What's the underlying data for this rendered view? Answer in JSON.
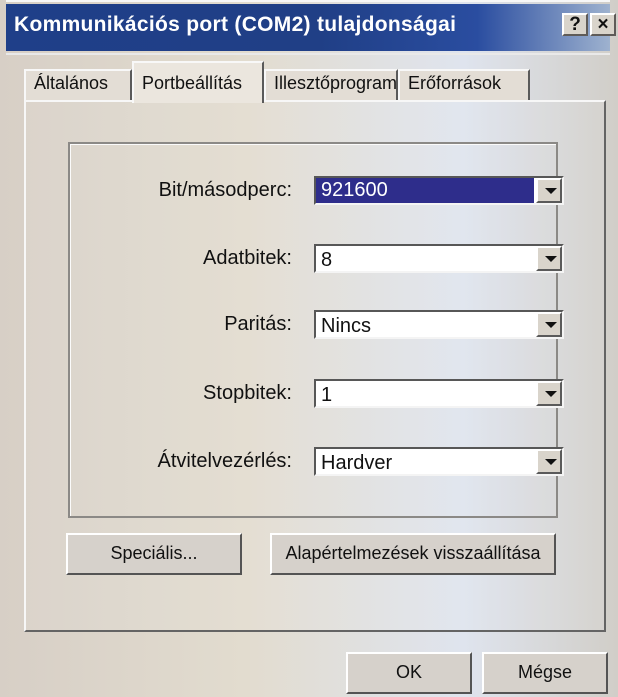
{
  "window": {
    "title": "Kommunikációs port (COM2) tulajdonságai",
    "help_button": "?",
    "close_button": "×"
  },
  "tabs": [
    {
      "label": "Általános"
    },
    {
      "label": "Portbeállítás"
    },
    {
      "label": "Illesztőprogram"
    },
    {
      "label": "Erőforrások"
    }
  ],
  "settings": {
    "fields": [
      {
        "label": "Bit/másodperc:",
        "value": "921600"
      },
      {
        "label": "Adatbitek:",
        "value": "8"
      },
      {
        "label": "Paritás:",
        "value": "Nincs"
      },
      {
        "label": "Stopbitek:",
        "value": "1"
      },
      {
        "label": "Átvitelvezérlés:",
        "value": "Hardver"
      }
    ]
  },
  "buttons": {
    "advanced": "Speciális...",
    "restore_defaults": "Alapértelmezések visszaállítása",
    "ok": "OK",
    "cancel": "Mégse"
  }
}
